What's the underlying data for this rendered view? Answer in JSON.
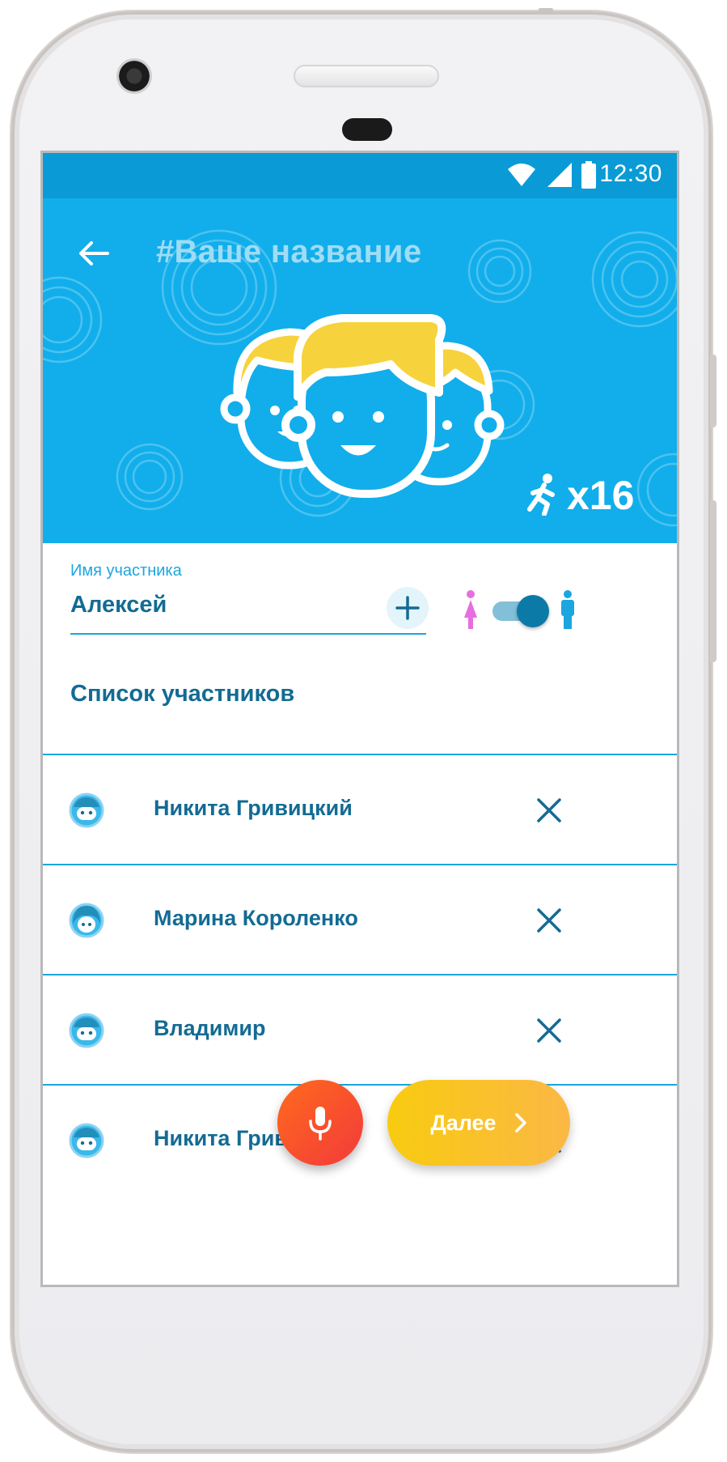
{
  "status_bar": {
    "time": "12:30",
    "wifi_icon": "wifi-icon",
    "signal_icon": "signal-icon",
    "battery_icon": "battery-icon"
  },
  "header": {
    "title": "#Ваше название",
    "back_icon": "arrow-left-icon",
    "participants_count": "x16",
    "background_color": "#11aeeb"
  },
  "participant_input": {
    "label": "Имя участника",
    "value": "Алексей",
    "add_icon": "plus-icon",
    "gender_female_icon": "female-icon",
    "gender_male_icon": "male-icon",
    "gender_toggle_on": true
  },
  "participants_section": {
    "title": "Список участников",
    "items": [
      {
        "name": "Никита Гривицкий",
        "avatar": "boy-avatar-icon"
      },
      {
        "name": "Марина Короленко",
        "avatar": "girl-avatar-icon"
      },
      {
        "name": "Владимир",
        "avatar": "boy-avatar-icon"
      },
      {
        "name": "Никита Гривицкий",
        "avatar": "boy-avatar-icon"
      }
    ]
  },
  "actions": {
    "mic_icon": "microphone-icon",
    "next_label": "Далее",
    "next_icon": "chevron-right-icon"
  },
  "colors": {
    "accent": "#1ba6df",
    "text_primary": "#136b93",
    "mic": "#f2533a",
    "next": "#f9c21f"
  }
}
